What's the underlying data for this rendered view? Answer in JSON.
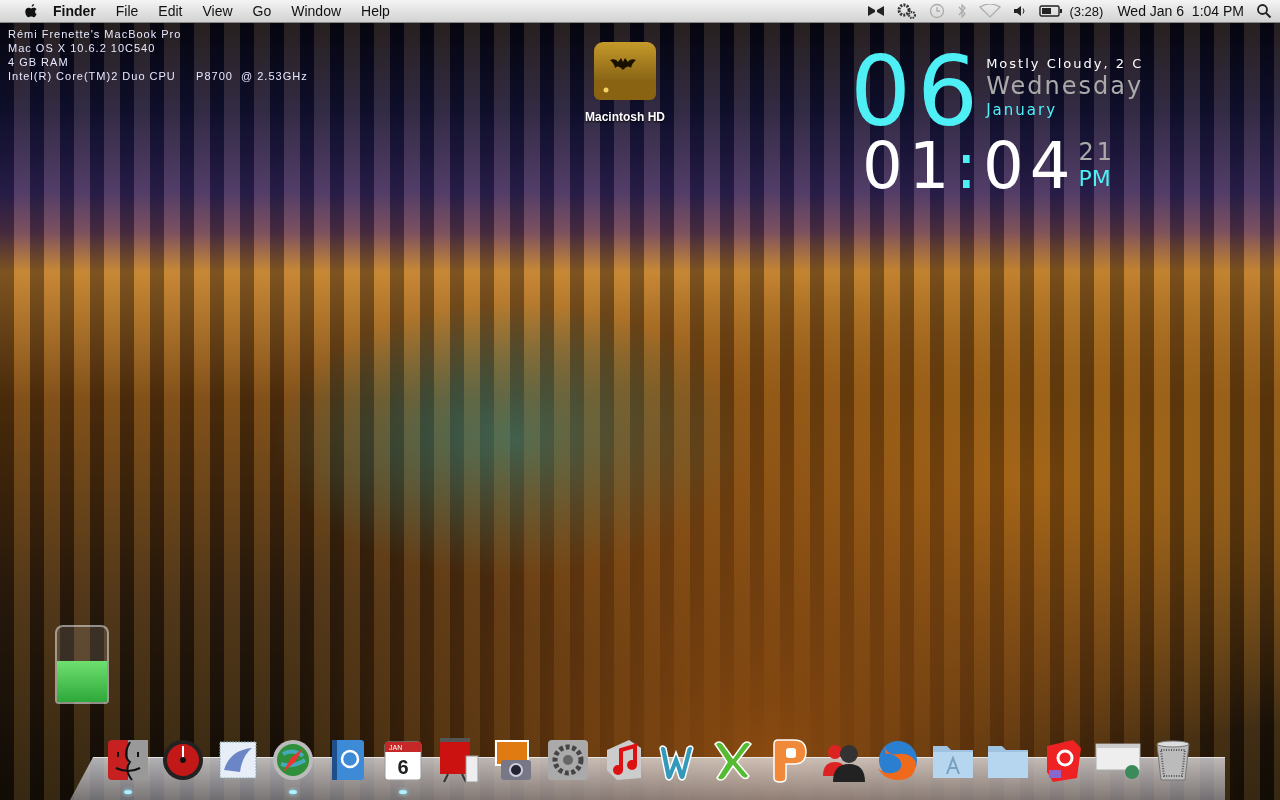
{
  "menu_bar": {
    "app_name": "Finder",
    "menus": [
      "File",
      "Edit",
      "View",
      "Go",
      "Window",
      "Help"
    ],
    "battery_time": "(3:28)",
    "clock": "Wed Jan 6  1:04 PM"
  },
  "system_info": [
    "Rémi Frenette's MacBook Pro",
    "Mac OS X 10.6.2 10C540",
    "4 GB RAM",
    "Intel(R) Core(TM)2 Duo CPU     P8700  @ 2.53GHz"
  ],
  "desktop_icons": [
    {
      "label": "Macintosh HD"
    }
  ],
  "clock_widget": {
    "day": "06",
    "weather": "Mostly Cloudy, 2 C",
    "weekday": "Wednesday",
    "month": "January",
    "hours": "01",
    "separator": ":",
    "minutes": "04",
    "seconds": "21",
    "meridiem": "PM"
  },
  "battery_widget": {
    "level": 0.55
  },
  "dock": {
    "items": [
      {
        "kind": "finder",
        "running": true
      },
      {
        "kind": "dashboard",
        "running": false
      },
      {
        "kind": "mail",
        "running": false
      },
      {
        "kind": "safari",
        "running": true
      },
      {
        "kind": "addressbook",
        "running": false
      },
      {
        "kind": "calendar",
        "running": true,
        "text_month": "JAN",
        "text_day": "6"
      },
      {
        "kind": "photobooth",
        "running": false
      },
      {
        "kind": "iphoto",
        "running": false
      },
      {
        "kind": "preferences",
        "running": false
      },
      {
        "kind": "music",
        "running": false
      },
      {
        "kind": "word",
        "running": false
      },
      {
        "kind": "excel",
        "running": false
      },
      {
        "kind": "powerpoint",
        "running": false
      },
      {
        "kind": "messenger",
        "running": false
      },
      {
        "kind": "firefox",
        "running": false
      },
      {
        "kind": "apps-folder",
        "running": false
      },
      {
        "kind": "folder",
        "running": false
      },
      {
        "kind": "red-app",
        "running": false
      },
      {
        "kind": "window-preview",
        "running": false
      },
      {
        "kind": "trash",
        "running": false
      }
    ]
  }
}
